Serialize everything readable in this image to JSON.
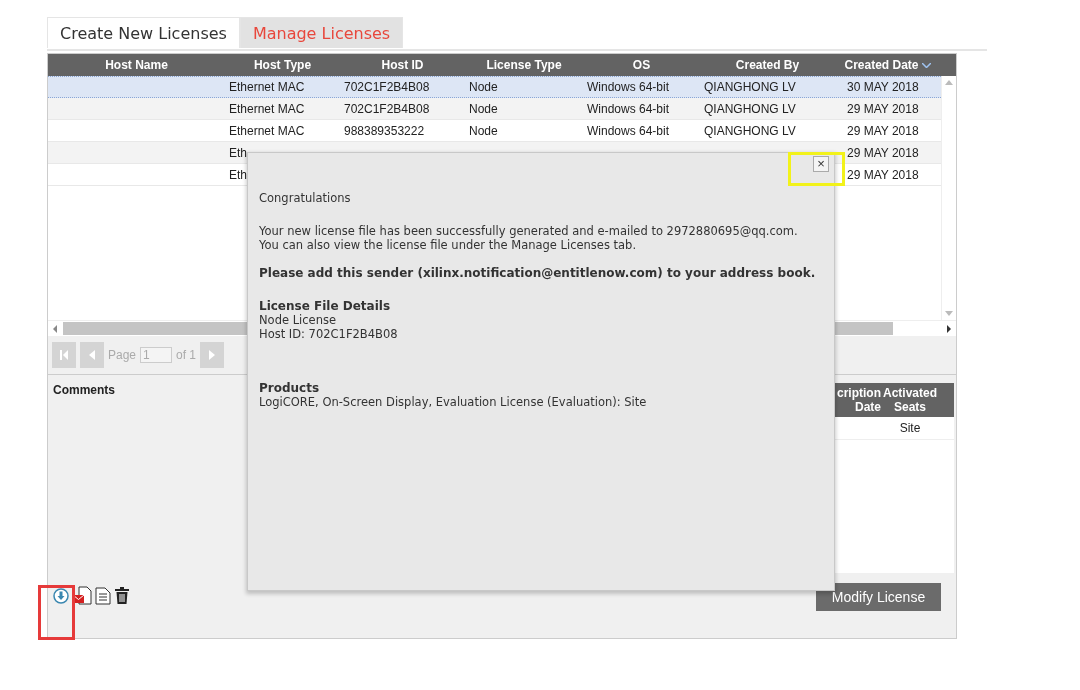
{
  "tabs": [
    {
      "label": "Create New Licenses",
      "selected": false
    },
    {
      "label": "Manage Licenses",
      "selected": true
    }
  ],
  "table": {
    "columns": [
      {
        "label": "Host Name",
        "sorted": false
      },
      {
        "label": "Host Type",
        "sorted": false
      },
      {
        "label": "Host ID",
        "sorted": false
      },
      {
        "label": "License Type",
        "sorted": false
      },
      {
        "label": "OS",
        "sorted": false
      },
      {
        "label": "Created By",
        "sorted": false
      },
      {
        "label": "Created Date",
        "sorted": true
      }
    ],
    "rows": [
      {
        "selected": true,
        "host_type": "Ethernet MAC",
        "host_id": "702C1F2B4B08",
        "license_type": "Node",
        "os": "Windows 64-bit",
        "created_by": "QIANGHONG LV",
        "created_date": "30 MAY 2018"
      },
      {
        "selected": false,
        "host_type": "Ethernet MAC",
        "host_id": "702C1F2B4B08",
        "license_type": "Node",
        "os": "Windows 64-bit",
        "created_by": "QIANGHONG LV",
        "created_date": "29 MAY 2018"
      },
      {
        "selected": false,
        "host_type": "Ethernet MAC",
        "host_id": "988389353222",
        "license_type": "Node",
        "os": "Windows 64-bit",
        "created_by": "QIANGHONG LV",
        "created_date": "29 MAY 2018"
      },
      {
        "selected": false,
        "host_type": "Eth",
        "created_date": "29 MAY 2018"
      },
      {
        "selected": false,
        "host_type": "Eth",
        "created_date": "29 MAY 2018"
      }
    ]
  },
  "pager": {
    "page_label": "Page",
    "page_value": "1",
    "of_label": "of 1"
  },
  "comments": {
    "label": "Comments"
  },
  "seats_table": {
    "columns": [
      "cription Date",
      "Activated Seats"
    ],
    "rows": [
      {
        "activated_seats": "Site"
      }
    ]
  },
  "modify_button": "Modify License",
  "dialog": {
    "title": "Congratulations",
    "message_lines": [
      "Your new license file has been successfully generated and e-mailed to 2972880695@qq.com.",
      "You can also view the license file under the Manage Licenses tab."
    ],
    "notice": "Please add this sender (xilinx.notification@entitlenow.com) to your address book.",
    "details_heading": "License File Details",
    "details_lines": [
      "Node License",
      "Host ID: 702C1F2B4B08"
    ],
    "products_heading": "Products",
    "products_text": "LogiCORE, On-Screen Display, Evaluation License (Evaluation): Site",
    "close": "×"
  }
}
